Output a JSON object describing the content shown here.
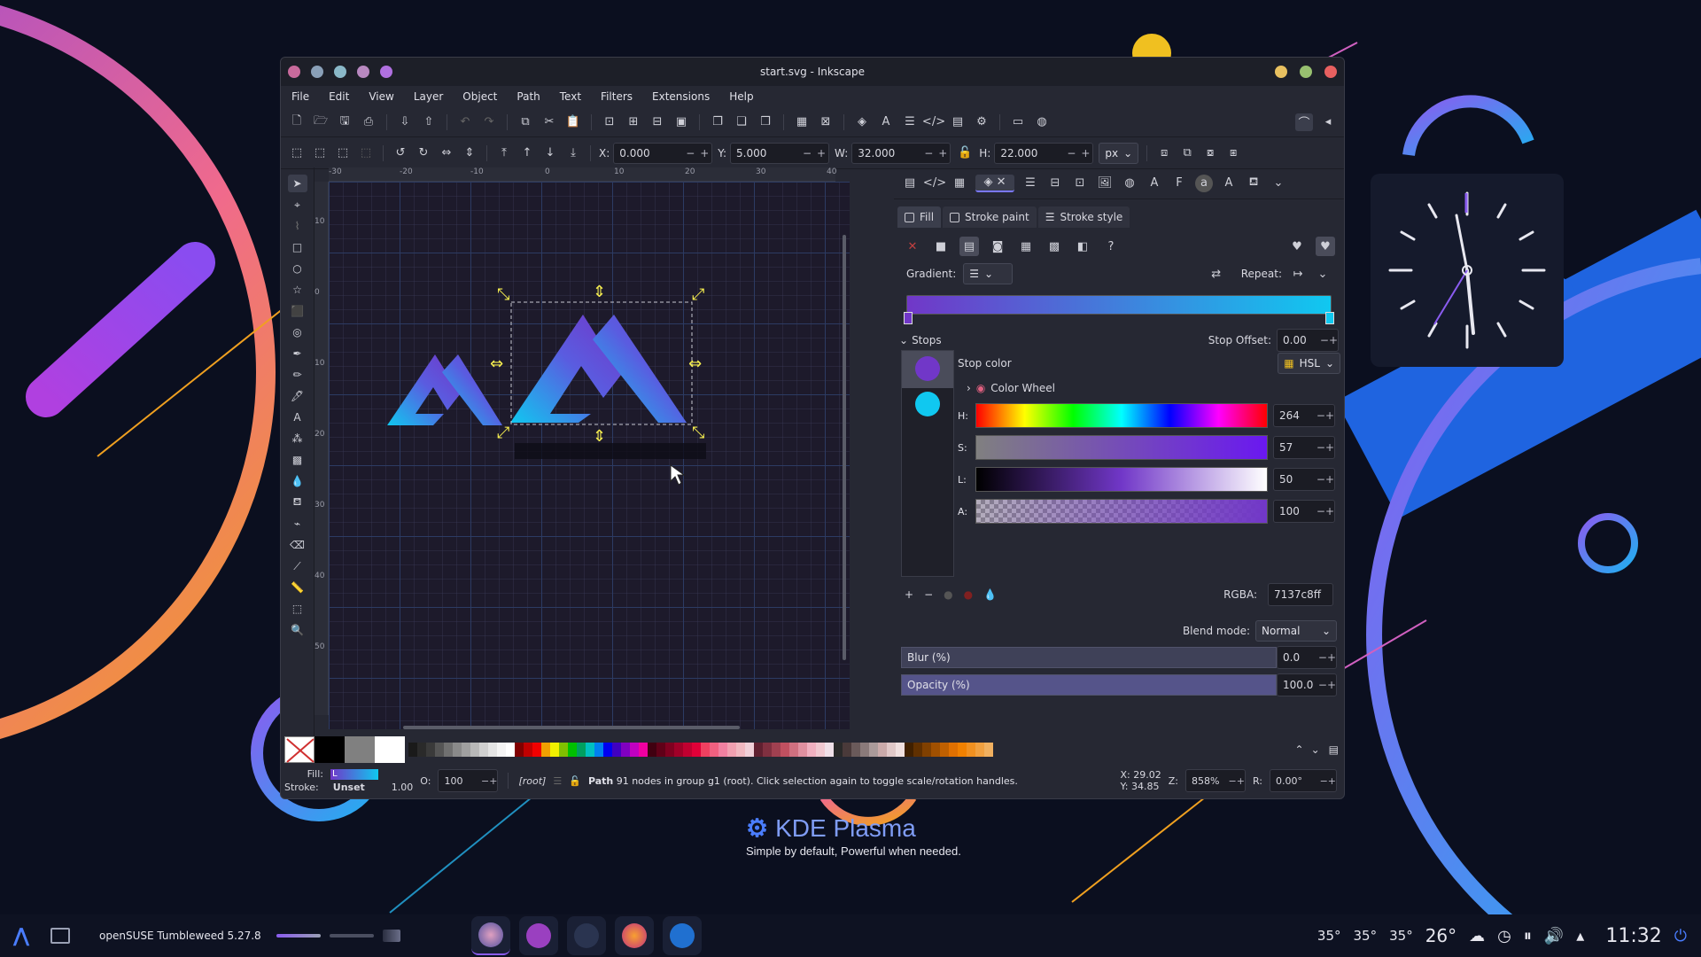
{
  "window": {
    "title": "start.svg - Inkscape"
  },
  "menu": [
    "File",
    "Edit",
    "View",
    "Layer",
    "Object",
    "Path",
    "Text",
    "Filters",
    "Extensions",
    "Help"
  ],
  "toolbar": {
    "x_label": "X:",
    "x_value": "0.000",
    "y_label": "Y:",
    "y_value": "5.000",
    "w_label": "W:",
    "w_value": "32.000",
    "h_label": "H:",
    "h_value": "22.000",
    "unit": "px"
  },
  "rulers": {
    "top": [
      "-30",
      "-20",
      "-10",
      "0",
      "10",
      "20",
      "30",
      "40"
    ],
    "left": [
      "10",
      "0",
      "10",
      "20",
      "30",
      "40",
      "50"
    ]
  },
  "fill_stroke": {
    "tabs": [
      "Fill",
      "Stroke paint",
      "Stroke style"
    ],
    "gradient_label": "Gradient:",
    "repeat_label": "Repeat:",
    "stops_label": "Stops",
    "stop_offset_label": "Stop Offset:",
    "stop_offset_value": "0.00",
    "stop_color_label": "Stop color",
    "color_mode": "HSL",
    "color_wheel_label": "Color Wheel",
    "sliders": [
      {
        "label": "H:",
        "value": "264"
      },
      {
        "label": "S:",
        "value": "57"
      },
      {
        "label": "L:",
        "value": "50"
      },
      {
        "label": "A:",
        "value": "100"
      }
    ],
    "rgba_label": "RGBA:",
    "rgba_value": "7137c8ff",
    "blend_label": "Blend mode:",
    "blend_value": "Normal",
    "blur_label": "Blur (%)",
    "blur_value": "0.0",
    "opacity_label": "Opacity (%)",
    "opacity_value": "100.0",
    "stops": [
      {
        "color": "#7137c8"
      },
      {
        "color": "#10c8f0"
      }
    ]
  },
  "status": {
    "fill_label": "Fill:",
    "fill_swatch": "L",
    "stroke_label": "Stroke:",
    "stroke_value": "Unset",
    "stroke_width": "1.00",
    "o_label": "O:",
    "o_value": "100",
    "layer": "[root]",
    "message_bold": "Path",
    "message": " 91 nodes in group g1 (root). Click selection again to toggle scale/rotation handles.",
    "x_label": "X:",
    "x_value": "29.02",
    "y_label": "Y:",
    "y_value": "34.85",
    "z_label": "Z:",
    "zoom": "858%",
    "r_label": "R:",
    "rotation": "0.00°"
  },
  "desktop": {
    "brand": "KDE Plasma",
    "tagline": "Simple by default, Powerful when needed."
  },
  "taskbar": {
    "os_label": "openSUSE Tumbleweed 5.27.8",
    "temps": [
      "35°",
      "35°",
      "35°"
    ],
    "weather": "26°",
    "time": "11:32"
  },
  "colors": {
    "accent": "#7a78ff",
    "gradient_start": "#7137c8",
    "gradient_end": "#10c8f0"
  }
}
